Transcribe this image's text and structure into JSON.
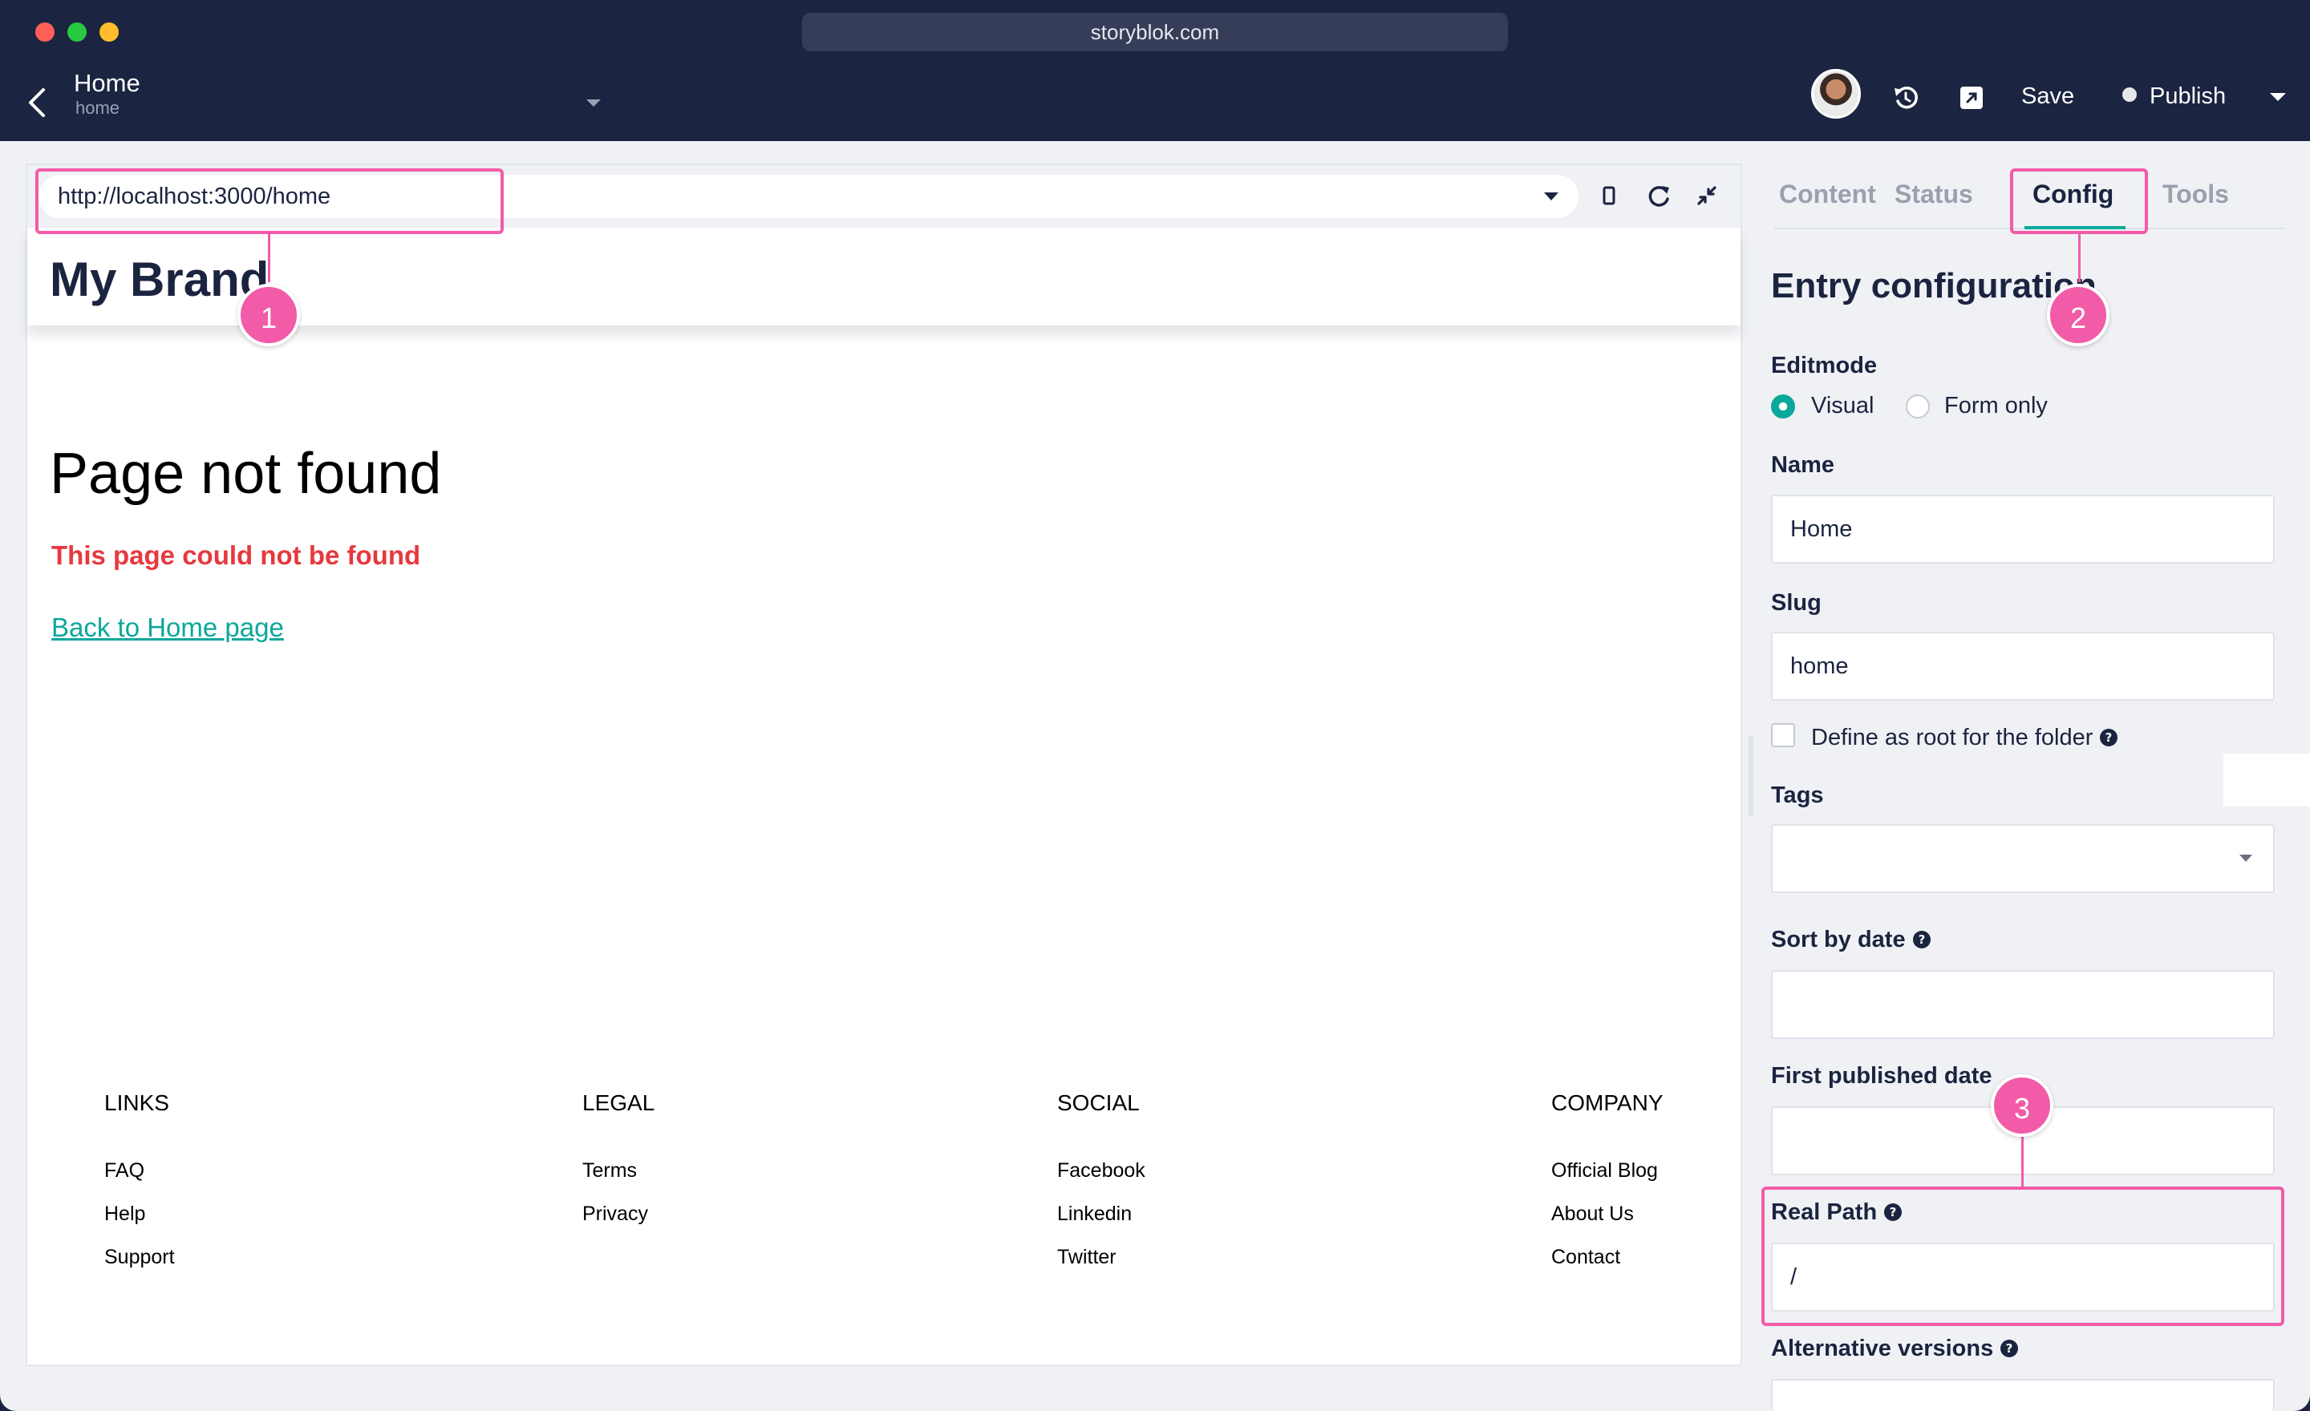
{
  "browser": {
    "address": "storyblok.com"
  },
  "header": {
    "story_name": "Home",
    "story_slug": "home",
    "save_label": "Save",
    "publish_label": "Publish"
  },
  "preview": {
    "url": "http://localhost:3000/home",
    "brand": "My Brand",
    "not_found_title": "Page not found",
    "not_found_subtitle": "This page could not be found",
    "back_link": "Back to Home page",
    "footer": [
      {
        "heading": "LINKS",
        "links": [
          "FAQ",
          "Help",
          "Support"
        ]
      },
      {
        "heading": "LEGAL",
        "links": [
          "Terms",
          "Privacy"
        ]
      },
      {
        "heading": "SOCIAL",
        "links": [
          "Facebook",
          "Linkedin",
          "Twitter"
        ]
      },
      {
        "heading": "COMPANY",
        "links": [
          "Official Blog",
          "About Us",
          "Contact"
        ]
      }
    ]
  },
  "panel": {
    "tabs": [
      "Content",
      "Status",
      "Config",
      "Tools"
    ],
    "active_tab": "Config",
    "title": "Entry configuration",
    "editmode_label": "Editmode",
    "editmode_options": [
      "Visual",
      "Form only"
    ],
    "editmode_selected": "Visual",
    "name_label": "Name",
    "name_value": "Home",
    "slug_label": "Slug",
    "slug_value": "home",
    "root_label": "Define as root for the folder",
    "root_checked": false,
    "tags_label": "Tags",
    "sort_label": "Sort by date",
    "first_published_label": "First published date",
    "real_path_label": "Real Path",
    "real_path_value": "/",
    "alt_versions_label": "Alternative versions"
  },
  "annotations": [
    "1",
    "2",
    "3"
  ],
  "colors": {
    "header_bg": "#1b2440",
    "accent": "#0aa89b",
    "error": "#e6393f",
    "highlight": "#f25ba7"
  },
  "icons": [
    "back-arrow-icon",
    "chevron-down-icon",
    "history-icon",
    "open-external-icon",
    "device-icon",
    "reload-icon",
    "collapse-icon",
    "help-icon"
  ]
}
